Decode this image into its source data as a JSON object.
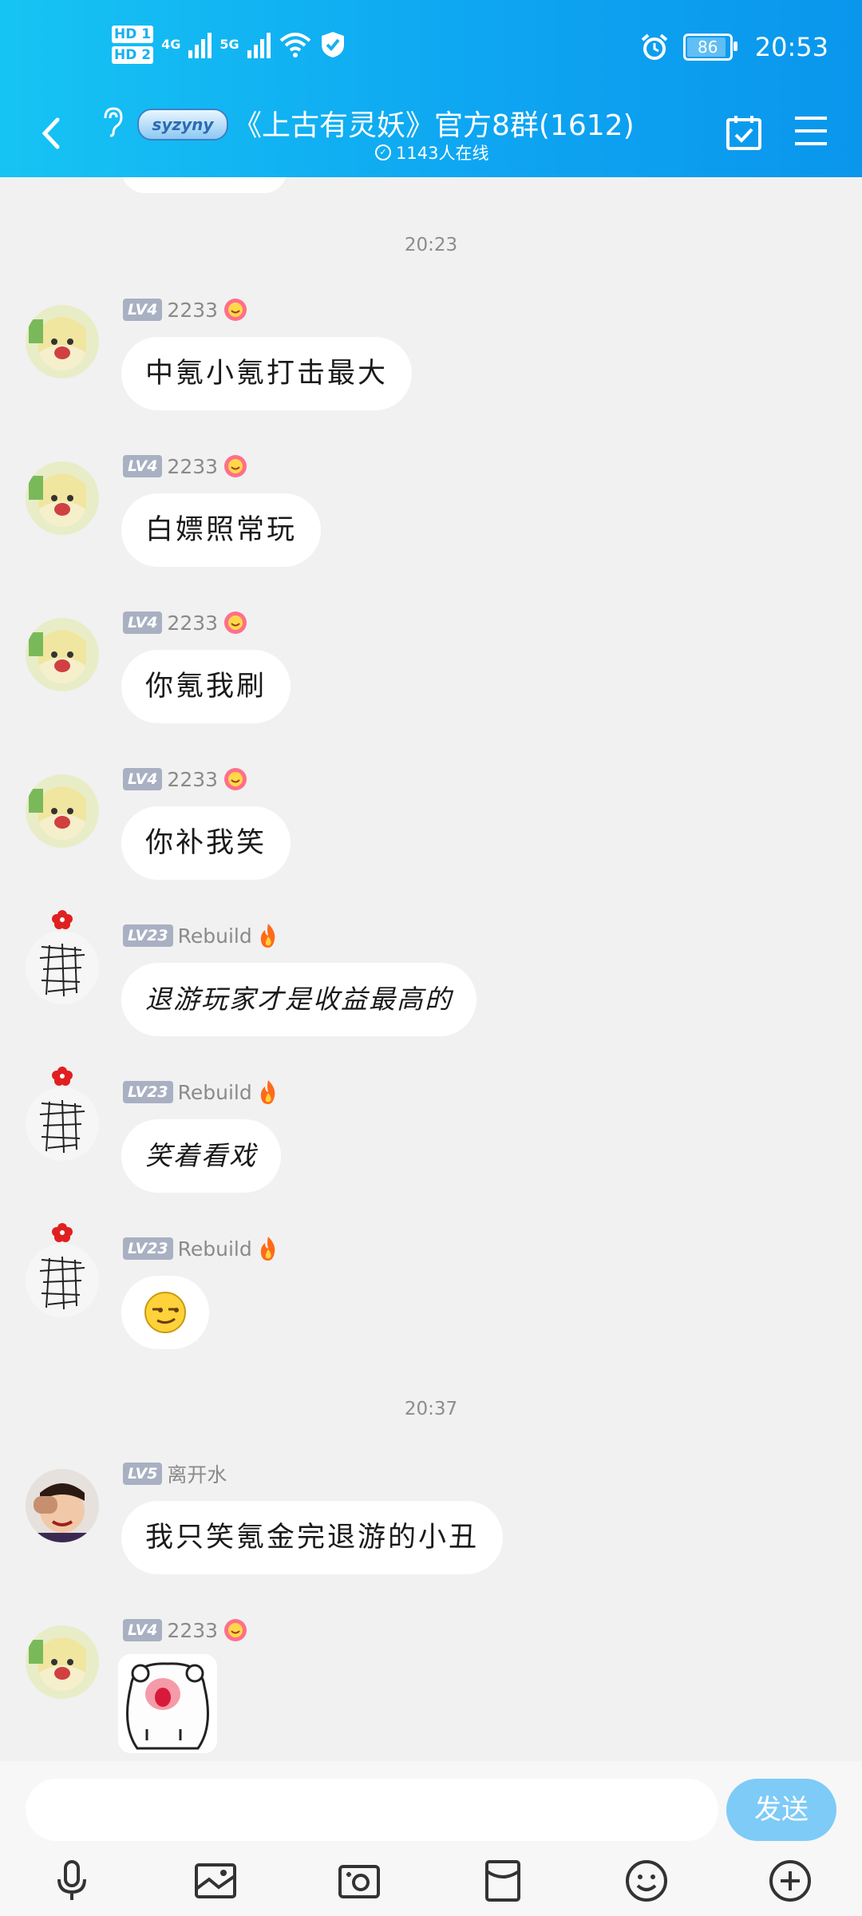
{
  "status_bar": {
    "hd1": "HD 1",
    "hd2": "HD 2",
    "net1": "4G",
    "net2": "5G",
    "battery": "86",
    "time": "20:53"
  },
  "header": {
    "badge": "syzyny",
    "title": "《上古有灵妖》官方8群(1612)",
    "online": "1143人在线"
  },
  "chat": {
    "timestamps": [
      "20:23",
      "20:37"
    ],
    "messages": [
      {
        "level": "LV4",
        "nick": "2233",
        "text": "中氪小氪打击最大"
      },
      {
        "level": "LV4",
        "nick": "2233",
        "text": "白嫖照常玩"
      },
      {
        "level": "LV4",
        "nick": "2233",
        "text": "你氪我刷"
      },
      {
        "level": "LV4",
        "nick": "2233",
        "text": "你补我笑"
      },
      {
        "level": "LV23",
        "nick": "Rebuild",
        "text": "退游玩家才是收益最高的"
      },
      {
        "level": "LV23",
        "nick": "Rebuild",
        "text": "笑着看戏"
      },
      {
        "level": "LV23",
        "nick": "Rebuild",
        "text": ""
      },
      {
        "level": "LV5",
        "nick": "离开水",
        "text": "我只笑氪金完退游的小丑"
      },
      {
        "level": "LV4",
        "nick": "2233",
        "text": ""
      }
    ]
  },
  "input": {
    "placeholder": "",
    "send_label": "发送"
  },
  "colors": {
    "header_start": "#16c4f3",
    "header_end": "#0a96ec",
    "send_button": "#7ecbf8",
    "level_badge": "#a8b0c2"
  }
}
